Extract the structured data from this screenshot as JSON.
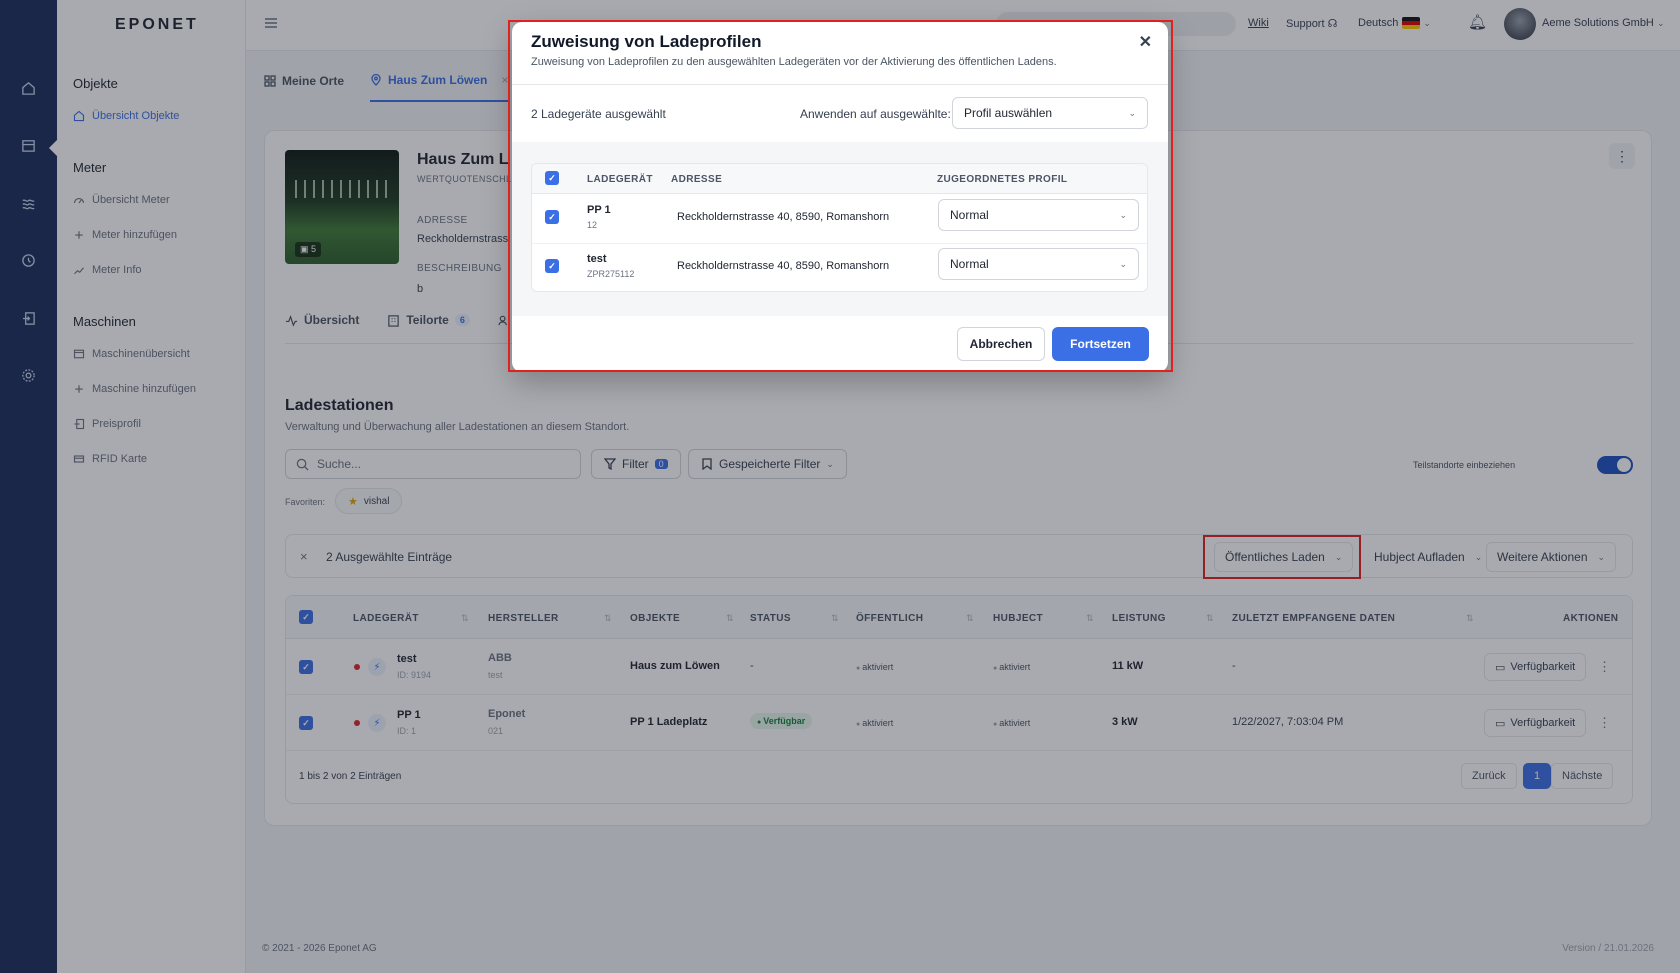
{
  "brand": "EPONET",
  "nav": {
    "sections": [
      {
        "title": "Objekte",
        "items": [
          {
            "label": "Übersicht Objekte",
            "icon": "home-icon",
            "active": true
          }
        ]
      },
      {
        "title": "Meter",
        "items": [
          {
            "label": "Übersicht Meter",
            "icon": "gauge-icon"
          },
          {
            "label": "Meter hinzufügen",
            "icon": "plus-icon"
          },
          {
            "label": "Meter Info",
            "icon": "chart-icon"
          }
        ]
      },
      {
        "title": "Maschinen",
        "items": [
          {
            "label": "Maschinenübersicht",
            "icon": "machine-icon"
          },
          {
            "label": "Maschine hinzufügen",
            "icon": "plus-icon"
          },
          {
            "label": "Preisprofil",
            "icon": "price-icon"
          },
          {
            "label": "RFID Karte",
            "icon": "card-icon"
          }
        ]
      }
    ]
  },
  "topbar": {
    "wiki": "Wiki",
    "support": "Support",
    "language": "Deutsch",
    "company": "Aeme Solutions GmbH"
  },
  "page_tabs": [
    {
      "label": "Meine Orte"
    },
    {
      "label": "Haus Zum Löwen",
      "active": true
    }
  ],
  "object": {
    "title": "Haus Zum Löwen",
    "title_visible": "Haus Zum L",
    "subtitle": "WERTQUOTENSCHLÜ",
    "photo_count": "5",
    "address_label": "ADRESSE",
    "address_value": "Reckholdernstrass",
    "description_label": "BESCHREIBUNG",
    "description_value": "b"
  },
  "sub_tabs": [
    {
      "label": "Übersicht"
    },
    {
      "label": "Teilorte",
      "count": "6"
    }
  ],
  "section": {
    "title": "Ladestationen",
    "description": "Verwaltung und Überwachung aller Ladestationen an diesem Standort."
  },
  "toolbar": {
    "search_placeholder": "Suche...",
    "filter_label": "Filter",
    "filter_count": "0",
    "saved_filters_label": "Gespeicherte Filter",
    "toggle_label": "Teilstandorte einbeziehen",
    "favorites_label": "Favoriten:",
    "favorite_chip": "vishal"
  },
  "bulk": {
    "selected_text": "2 Ausgewählte Einträge",
    "public_charging": "Öffentliches Laden",
    "hubject": "Hubject Aufladen",
    "more_actions": "Weitere Aktionen"
  },
  "table": {
    "headers": [
      "LADEGERÄT",
      "HERSTELLER",
      "OBJEKTE",
      "STATUS",
      "ÖFFENTLICH",
      "HUBJECT",
      "LEISTUNG",
      "ZULETZT EMPFANGENE DATEN",
      "AKTIONEN"
    ],
    "rows": [
      {
        "name": "test",
        "id": "ID: 9194",
        "maker": "ABB",
        "maker_sub": "test",
        "object": "Haus zum Löwen",
        "status": "-",
        "public": "aktiviert",
        "hubject": "aktiviert",
        "power": "11 kW",
        "last": "-",
        "action": "Verfügbarkeit"
      },
      {
        "name": "PP 1",
        "id": "ID: 1",
        "maker": "Eponet",
        "maker_sub": "021",
        "object": "PP 1 Ladeplatz",
        "status": "Verfügbar",
        "public": "aktiviert",
        "hubject": "aktiviert",
        "power": "3 kW",
        "last": "1/22/2027, 7:03:04 PM",
        "action": "Verfügbarkeit"
      }
    ],
    "footer": "1 bis 2 von 2 Einträgen",
    "prev": "Zurück",
    "page": "1",
    "next": "Nächste"
  },
  "footer": {
    "copyright": "© 2021 - 2026 Eponet AG",
    "version": "Version / 21.01.2026"
  },
  "modal": {
    "title": "Zuweisung von Ladeprofilen",
    "description": "Zuweisung von Ladeprofilen zu den ausgewählten Ladegeräten vor der Aktivierung des öffentlichen Ladens.",
    "selected_count": "2 Ladegeräte ausgewählt",
    "apply_label": "Anwenden auf ausgewählte:",
    "apply_select": "Profil auswählen",
    "headers": [
      "LADEGERÄT",
      "ADRESSE",
      "ZUGEORDNETES PROFIL"
    ],
    "rows": [
      {
        "name": "PP 1",
        "sub": "12",
        "address": "Reckholdernstrasse 40, 8590, Romanshorn",
        "profile": "Normal"
      },
      {
        "name": "test",
        "sub": "ZPR275112",
        "address": "Reckholdernstrasse 40, 8590, Romanshorn",
        "profile": "Normal"
      }
    ],
    "cancel": "Abbrechen",
    "confirm": "Fortsetzen"
  },
  "colors": {
    "primary": "#3b6fe6",
    "rail": "#1b2d5a",
    "highlight": "#e0211d"
  }
}
